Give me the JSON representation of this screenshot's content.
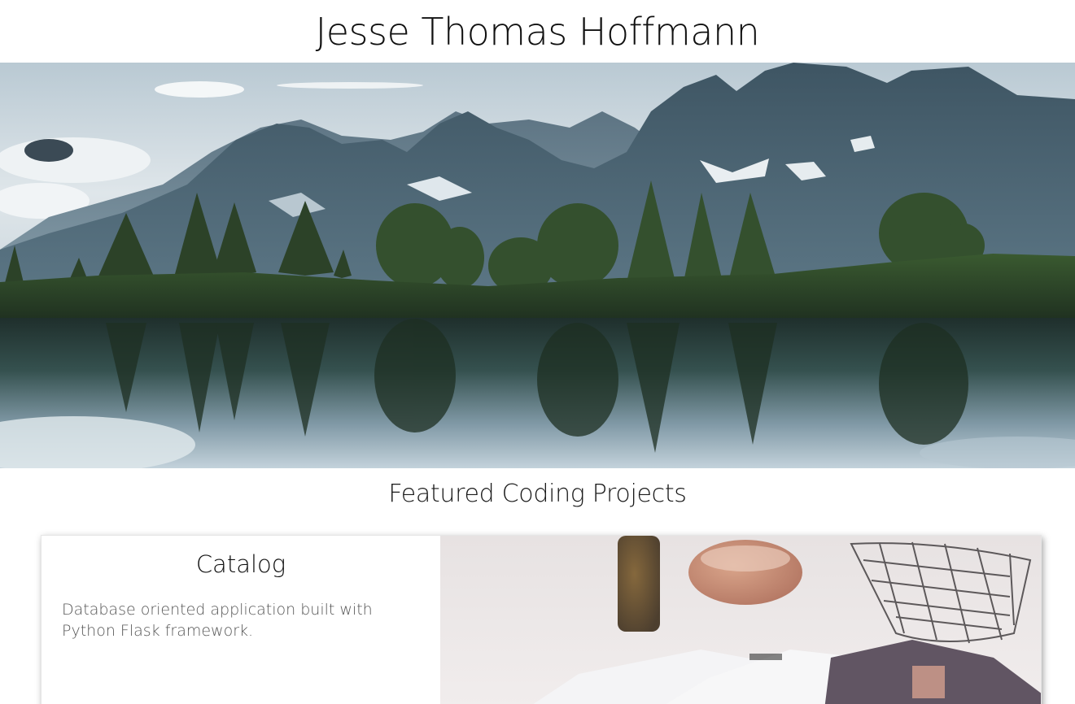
{
  "site": {
    "title": "Jesse Thomas Hoffmann"
  },
  "hero": {
    "image_description": "mountain-lake-banner"
  },
  "projects_section": {
    "heading": "Featured Coding Projects",
    "projects": [
      {
        "title": "Catalog",
        "description": "Database oriented application built with Python Flask framework."
      }
    ]
  },
  "colors": {
    "title_text": "#111111",
    "body_text": "#555555",
    "background": "#ffffff"
  }
}
